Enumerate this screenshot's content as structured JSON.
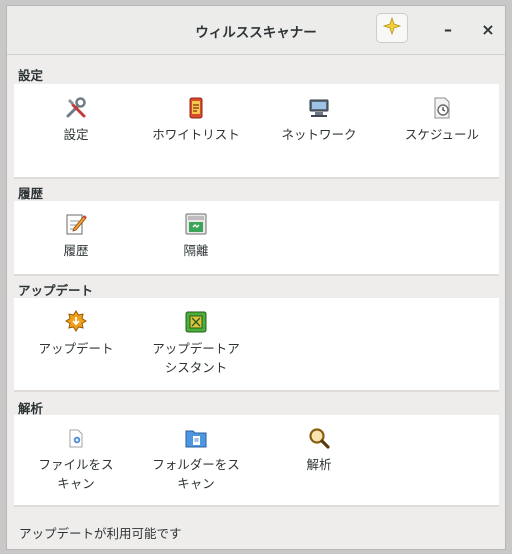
{
  "window": {
    "title": "ウィルススキャナー",
    "minimize_label": "–",
    "close_label": "×"
  },
  "icons": {
    "spark": "sparkle-icon"
  },
  "sections": {
    "settings": {
      "title": "設定",
      "items": [
        {
          "label": "設定",
          "icon": "tools-icon"
        },
        {
          "label": "ホワイトリスト",
          "icon": "whitelist-icon"
        },
        {
          "label": "ネットワーク",
          "icon": "network-icon"
        },
        {
          "label": "スケジュール",
          "icon": "schedule-icon"
        }
      ]
    },
    "history": {
      "title": "履歴",
      "items": [
        {
          "label": "履歴",
          "icon": "notepad-icon"
        },
        {
          "label": "隔離",
          "icon": "quarantine-icon"
        }
      ]
    },
    "update": {
      "title": "アップデート",
      "items": [
        {
          "label": "アップデート",
          "icon": "update-icon"
        },
        {
          "label": "アップデートア\nシスタント",
          "icon": "update-assistant-icon"
        }
      ]
    },
    "analysis": {
      "title": "解析",
      "items": [
        {
          "label": "ファイルをス\nキャン",
          "icon": "scan-file-icon"
        },
        {
          "label": "フォルダーをス\nキャン",
          "icon": "scan-folder-icon"
        },
        {
          "label": "解析",
          "icon": "magnifier-icon"
        }
      ]
    }
  },
  "status": {
    "text": "アップデートが利用可能です"
  },
  "colors": {
    "accent_yellow": "#f3d03d",
    "panel_bg": "#ffffff",
    "window_bg": "#efedec"
  }
}
